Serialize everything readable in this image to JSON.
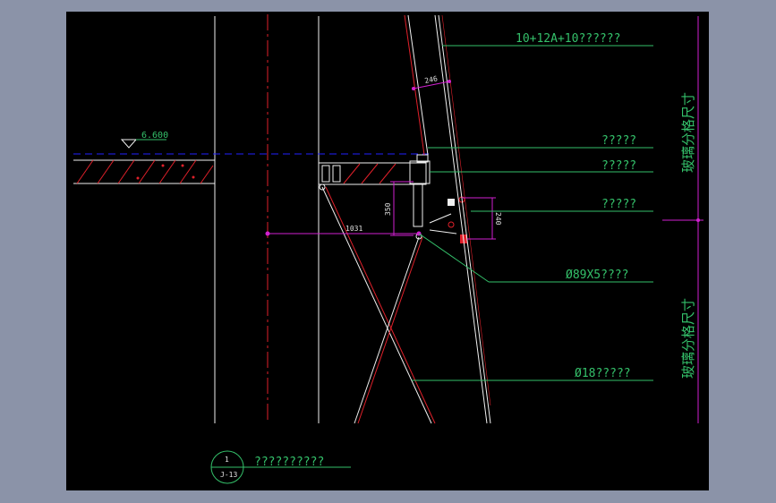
{
  "annotations": {
    "glass_spec": "10+12A+10??????",
    "elevation": "6.600",
    "label_1": "?????",
    "label_2": "?????",
    "label_3": "?????",
    "pipe_spec": "Ø89X5????",
    "rod_spec": "Ø18?????",
    "dim_246": "246",
    "dim_350": "350",
    "dim_1031": "1031",
    "dim_240": "240",
    "vertical_label_top": "玻璃分格尺寸",
    "vertical_label_bottom": "玻璃分格尺寸"
  },
  "title_block": {
    "number": "1",
    "sheet": "J-13",
    "caption": "??????????"
  },
  "colors": {
    "background": "#000000",
    "frame": "#8b93a8",
    "leader": "#34c06a",
    "dimension": "#d020d0",
    "axis": "#e0202a",
    "line": "#f0f0f0",
    "level": "#2020ff"
  }
}
